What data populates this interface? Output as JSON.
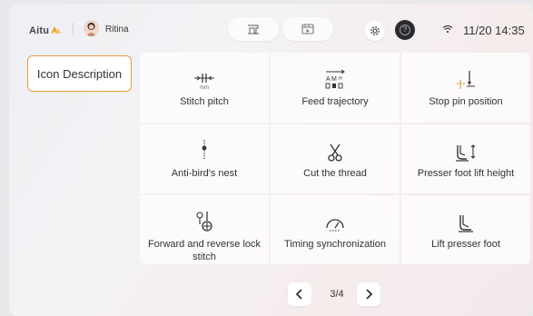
{
  "header": {
    "brand": "Aitu",
    "user_name": "Ritina",
    "time": "11/20 14:35",
    "icons": {
      "machine": "sewing-machine-icon",
      "media": "media-window-icon",
      "settings": "gear-icon",
      "help": "help-icon",
      "wifi": "wifi-icon"
    }
  },
  "sidebar": {
    "tab_label": "Icon Description"
  },
  "icons_grid": [
    {
      "label": "Stitch pitch",
      "icon": "stitch-pitch-icon"
    },
    {
      "label": "Feed trajectory",
      "icon": "feed-trajectory-icon"
    },
    {
      "label": "Stop pin position",
      "icon": "stop-pin-position-icon"
    },
    {
      "label": "Anti-bird's nest",
      "icon": "anti-birds-nest-icon"
    },
    {
      "label": "Cut the thread",
      "icon": "scissors-icon"
    },
    {
      "label": "Presser foot lift height",
      "icon": "presser-foot-lift-height-icon"
    },
    {
      "label": "Forward and reverse lock stitch",
      "icon": "lock-stitch-icon"
    },
    {
      "label": "Timing synchronization",
      "icon": "timing-gauge-icon"
    },
    {
      "label": "Lift presser foot",
      "icon": "presser-foot-icon"
    }
  ],
  "pagination": {
    "page_text": "3/4"
  },
  "colors": {
    "accent": "#e89b3d",
    "text": "#333333"
  }
}
